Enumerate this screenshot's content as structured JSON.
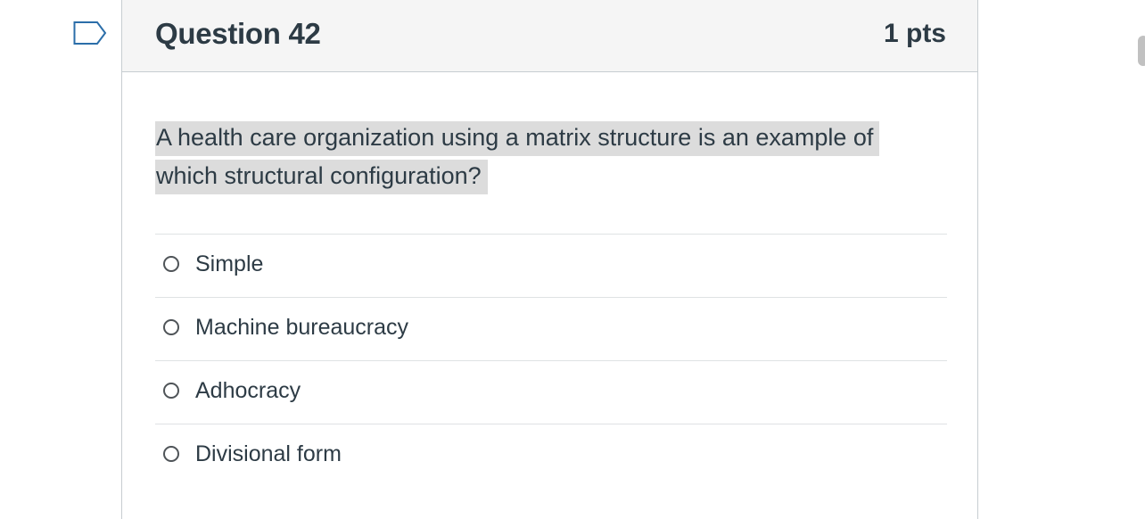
{
  "question": {
    "title": "Question 42",
    "points": "1 pts",
    "text": "A health care organization using a matrix structure is an example of which structural configuration?"
  },
  "answers": [
    {
      "label": "Simple"
    },
    {
      "label": "Machine bureaucracy"
    },
    {
      "label": "Adhocracy"
    },
    {
      "label": "Divisional form"
    }
  ],
  "icons": {
    "flag": "flag-question-icon",
    "radio": "radio-unselected-icon"
  },
  "colors": {
    "header_bg": "#f5f5f5",
    "text": "#2d3b45",
    "highlight": "#dcdcdc",
    "flag_outline": "#2b6ea9"
  }
}
